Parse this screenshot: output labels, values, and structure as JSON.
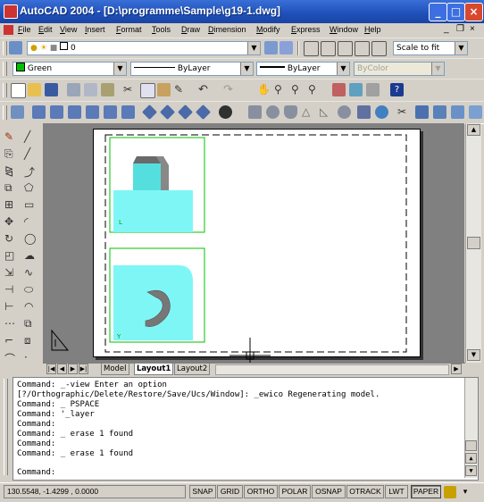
{
  "window": {
    "title": "AutoCAD 2004 - [D:\\programme\\Sample\\g19-1.dwg]",
    "minimize": "_",
    "maximize": "□",
    "close": "×"
  },
  "menubar": {
    "items": [
      "File",
      "Edit",
      "View",
      "Insert",
      "Format",
      "Tools",
      "Draw",
      "Dimension",
      "Modify",
      "Express",
      "Window",
      "Help"
    ],
    "doc_min": "_",
    "doc_restore": "❐",
    "doc_close": "×"
  },
  "layers": {
    "current_layer": "0",
    "scale": "Scale to fit"
  },
  "properties": {
    "color": "Green",
    "color_hex": "#00c000",
    "linetype": "ByLayer",
    "lineweight": "ByLayer",
    "plotstyle": "ByColor"
  },
  "layout_tabs": {
    "model": "Model",
    "layout1": "Layout1",
    "layout2": "Layout2"
  },
  "command_window": {
    "lines": [
      "Command: _-view Enter an option",
      "[?/Orthographic/Delete/Restore/Save/Ucs/Window]: _ewico Regenerating model.",
      "Command: _ PSPACE",
      "Command: '_layer",
      "Command:",
      "Command: _ erase 1 found",
      "Command:",
      "Command: _ erase 1 found",
      "",
      "Command:"
    ]
  },
  "statusbar": {
    "coords": "130.5548, -1.4299 , 0.0000",
    "snap": "SNAP",
    "grid": "GRID",
    "ortho": "ORTHO",
    "polar": "POLAR",
    "osnap": "OSNAP",
    "otrack": "OTRACK",
    "lwt": "LWT",
    "paper": "PAPER"
  },
  "colors": {
    "viewport_border": "#00c000",
    "model_fill": "#7ff6f6",
    "title_bar": "#2456c4"
  }
}
